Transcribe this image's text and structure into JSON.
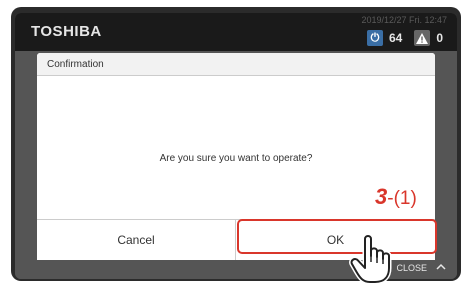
{
  "header": {
    "brand": "TOSHIBA",
    "datetime": "2019/12/27 Fri. 12:47",
    "power_count": "64",
    "alarm_count": "0"
  },
  "dialog": {
    "title": "Confirmation",
    "message": "Are you sure you want to operate?",
    "cancel_label": "Cancel",
    "ok_label": "OK"
  },
  "footer": {
    "close_label": "CLOSE"
  },
  "annotation": {
    "step_number": "3",
    "step_suffix": "-(1)"
  },
  "colors": {
    "accent_red": "#d9362b",
    "power_icon": "#3a6ea5"
  },
  "icons": [
    "power-icon",
    "warning-icon",
    "chevron-up-icon",
    "hand-cursor-icon"
  ]
}
